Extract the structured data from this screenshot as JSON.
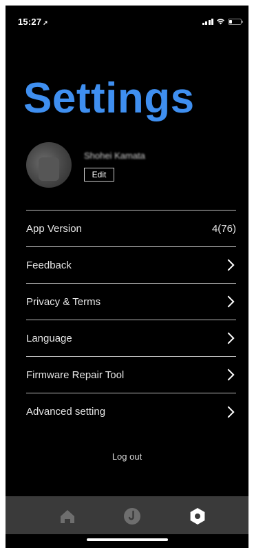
{
  "status_bar": {
    "time": "15:27",
    "location_glyph": "➚",
    "icons": [
      "signal-icon",
      "wifi-icon",
      "battery-icon"
    ]
  },
  "page": {
    "title": "Settings",
    "title_color": "#3f8ff0"
  },
  "profile": {
    "name": "Shohei Kamata",
    "edit_label": "Edit"
  },
  "settings_items": [
    {
      "label": "App Version",
      "value": "4(76)"
    },
    {
      "label": "Feedback"
    },
    {
      "label": "Privacy & Terms"
    },
    {
      "label": "Language"
    },
    {
      "label": "Firmware Repair Tool"
    },
    {
      "label": "Advanced setting"
    }
  ],
  "logout_label": "Log out",
  "tab_bar": {
    "tabs": [
      {
        "icon": "home-icon",
        "active": false
      },
      {
        "icon": "j-icon",
        "active": false
      },
      {
        "icon": "settings-hex-icon",
        "active": true
      }
    ],
    "background": "#3a3a3a"
  }
}
